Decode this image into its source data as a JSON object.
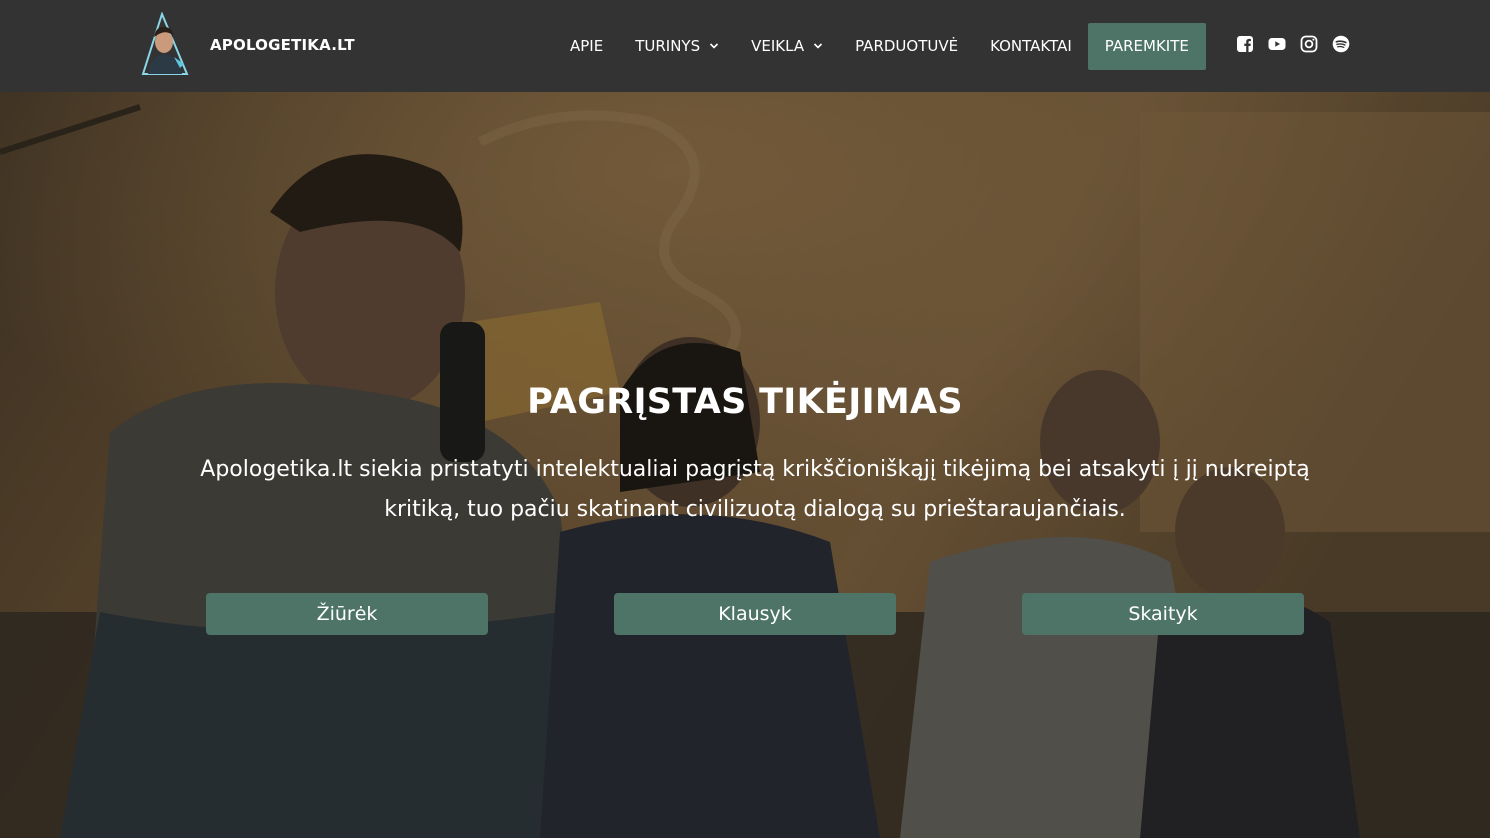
{
  "brand": {
    "name": "APOLOGETIKA.LT",
    "logo_icon": "portrait-triangle-logo"
  },
  "nav": {
    "items": [
      {
        "label": "APIE",
        "dropdown": false
      },
      {
        "label": "TURINYS",
        "dropdown": true
      },
      {
        "label": "VEIKLA",
        "dropdown": true
      },
      {
        "label": "PARDUOTUVĖ",
        "dropdown": false
      },
      {
        "label": "KONTAKTAI",
        "dropdown": false
      }
    ],
    "cta_label": "PAREMKITE"
  },
  "socials": [
    {
      "icon": "facebook-icon"
    },
    {
      "icon": "youtube-icon"
    },
    {
      "icon": "instagram-icon"
    },
    {
      "icon": "spotify-icon"
    }
  ],
  "hero": {
    "title": "PAGRĮSTAS TIKĖJIMAS",
    "description": "Apologetika.lt siekia pristatyti intelektualiai pagrįstą krikščioniškąjį tikėjimą bei atsakyti į jį nukreiptą kritiką, tuo pačiu skatinant civilizuotą dialogą su prieštaraujančiais.",
    "buttons": [
      {
        "label": "Žiūrėk"
      },
      {
        "label": "Klausyk"
      },
      {
        "label": "Skaityk"
      }
    ]
  },
  "colors": {
    "header_bg": "#333333",
    "accent": "#4e7468",
    "text": "#ffffff"
  }
}
